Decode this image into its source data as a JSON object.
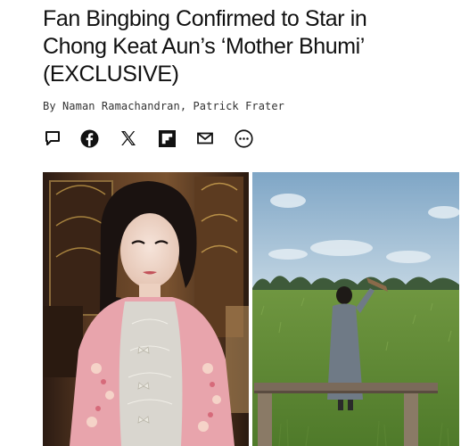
{
  "article": {
    "headline_lines": [
      "Fan Bingbing Confirmed to Star in",
      "Chong Keat Aun’s ‘Mother Bhumi’",
      "(EXCLUSIVE)"
    ],
    "byline": "By Naman Ramachandran, Patrick Frater"
  },
  "share_icons": [
    "comment-icon",
    "facebook-icon",
    "x-icon",
    "flipboard-icon",
    "email-icon",
    "more-icon"
  ],
  "colors": {
    "text": "#111111",
    "icon": "#111111",
    "field_green": "#5f8a3a",
    "sky": "#8fb3cf"
  }
}
